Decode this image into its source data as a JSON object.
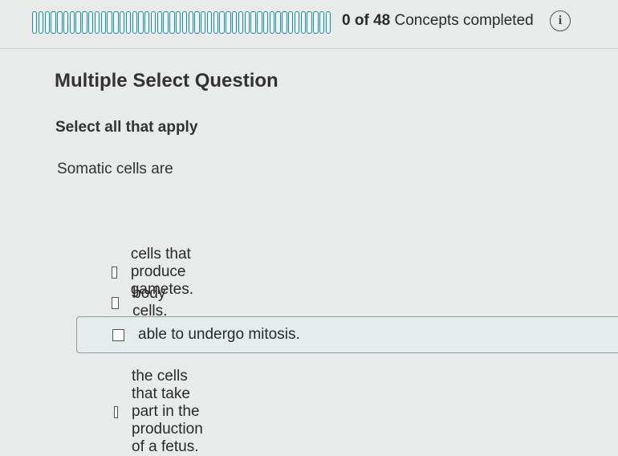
{
  "progress": {
    "completed": "0",
    "total": "48",
    "of_text": "of",
    "suffix": "Concepts completed",
    "segment_count": 48
  },
  "info_button": {
    "icon": "info-icon",
    "glyph": "i"
  },
  "question": {
    "type": "Multiple Select Question",
    "instruction": "Select all that apply",
    "prompt": "Somatic cells are"
  },
  "options": [
    {
      "label": "cells that produce gametes.",
      "checked": false
    },
    {
      "label": "body cells.",
      "checked": false
    },
    {
      "label": "able to undergo mitosis.",
      "checked": false
    },
    {
      "label": "the cells that take part in the production of a fetus.",
      "checked": false
    }
  ]
}
